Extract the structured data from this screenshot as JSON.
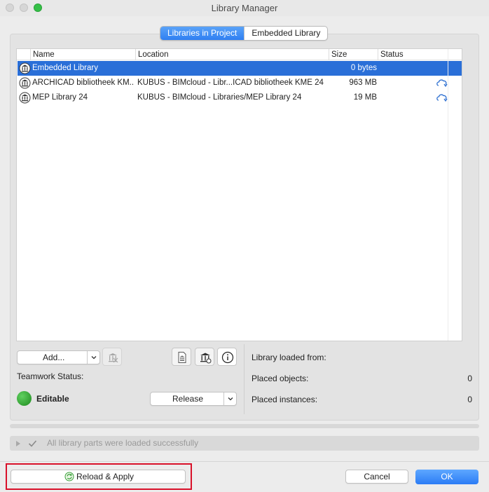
{
  "window": {
    "title": "Library Manager"
  },
  "tabs": [
    {
      "label": "Libraries in Project",
      "active": true
    },
    {
      "label": "Embedded Library",
      "active": false
    }
  ],
  "table": {
    "headers": [
      "Name",
      "Location",
      "Size",
      "Status"
    ],
    "rows": [
      {
        "name": "Embedded Library",
        "location": "",
        "size": "0 bytes",
        "status_icon": "",
        "selected": true
      },
      {
        "name": "ARCHICAD bibliotheek KM...",
        "location": "KUBUS - BIMcloud - Libr...ICAD bibliotheek KME 24",
        "size": "963 MB",
        "status_icon": "cloud-sync-icon",
        "selected": false
      },
      {
        "name": "MEP Library 24",
        "location": "KUBUS - BIMcloud - Libraries/MEP Library 24",
        "size": "19 MB",
        "status_icon": "cloud-sync-icon",
        "selected": false
      }
    ]
  },
  "left_controls": {
    "add_label": "Add...",
    "teamwork_status_label": "Teamwork Status:",
    "teamwork_state": "Editable",
    "release_label": "Release",
    "status_color": "#2e9f2e"
  },
  "right_info": {
    "loaded_from_label": "Library loaded from:",
    "placed_objects_label": "Placed objects:",
    "placed_objects_value": "0",
    "placed_instances_label": "Placed instances:",
    "placed_instances_value": "0"
  },
  "message": {
    "text": "All library parts were loaded successfully"
  },
  "footer": {
    "reload_label": "Reload & Apply",
    "cancel_label": "Cancel",
    "ok_label": "OK"
  },
  "colors": {
    "accent": "#2f7ff2",
    "highlight_frame": "#d9112a"
  }
}
